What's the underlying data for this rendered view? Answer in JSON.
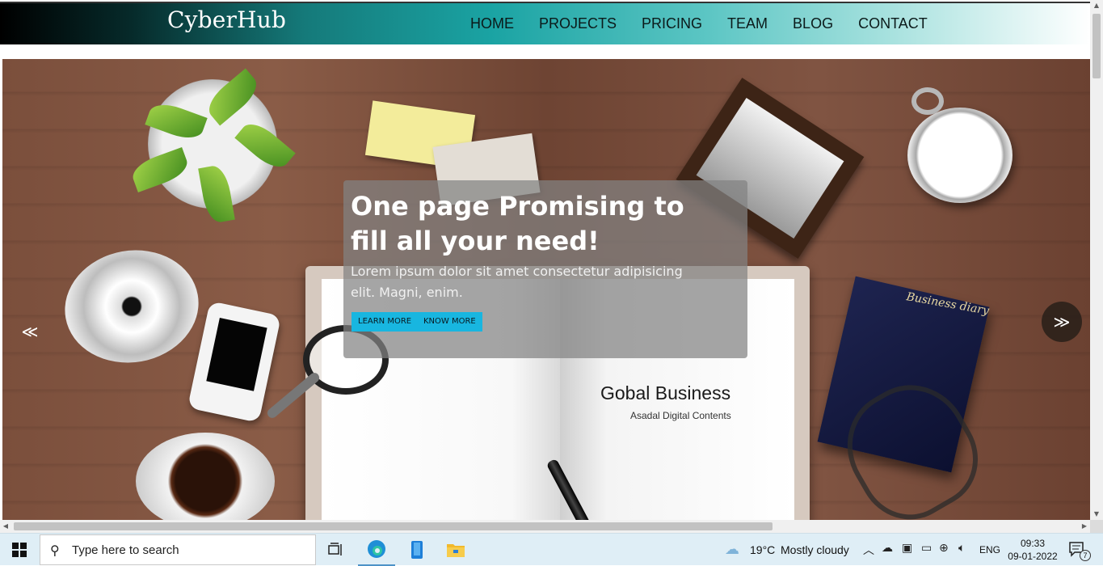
{
  "site": {
    "brand": "CyberHub",
    "nav": [
      "HOME",
      "PROJECTS",
      "PRICING",
      "TEAM",
      "BLOG",
      "CONTACT"
    ]
  },
  "hero": {
    "heading": "One page Promising to fill all your need!",
    "body": "Lorem ipsum dolor sit amet consectetur adipisicing elit. Magni, enim.",
    "learn_more": "LEARN MORE",
    "know_more": "KNOW MORE",
    "prev_arrow": "≪",
    "next_arrow": "≫",
    "image_text": {
      "notebook_title": "Gobal Business",
      "notebook_sub": "Asadal Digital Contents",
      "diary": "Business diary"
    }
  },
  "taskbar": {
    "search_placeholder": "Type here to search",
    "weather_temp": "19°C",
    "weather_desc": "Mostly cloudy",
    "language": "ENG",
    "time": "09:33",
    "date": "09-01-2022",
    "notifications": "7"
  },
  "colors": {
    "button_bg": "#18b6e0",
    "header_accent": "#1aa3a3"
  }
}
